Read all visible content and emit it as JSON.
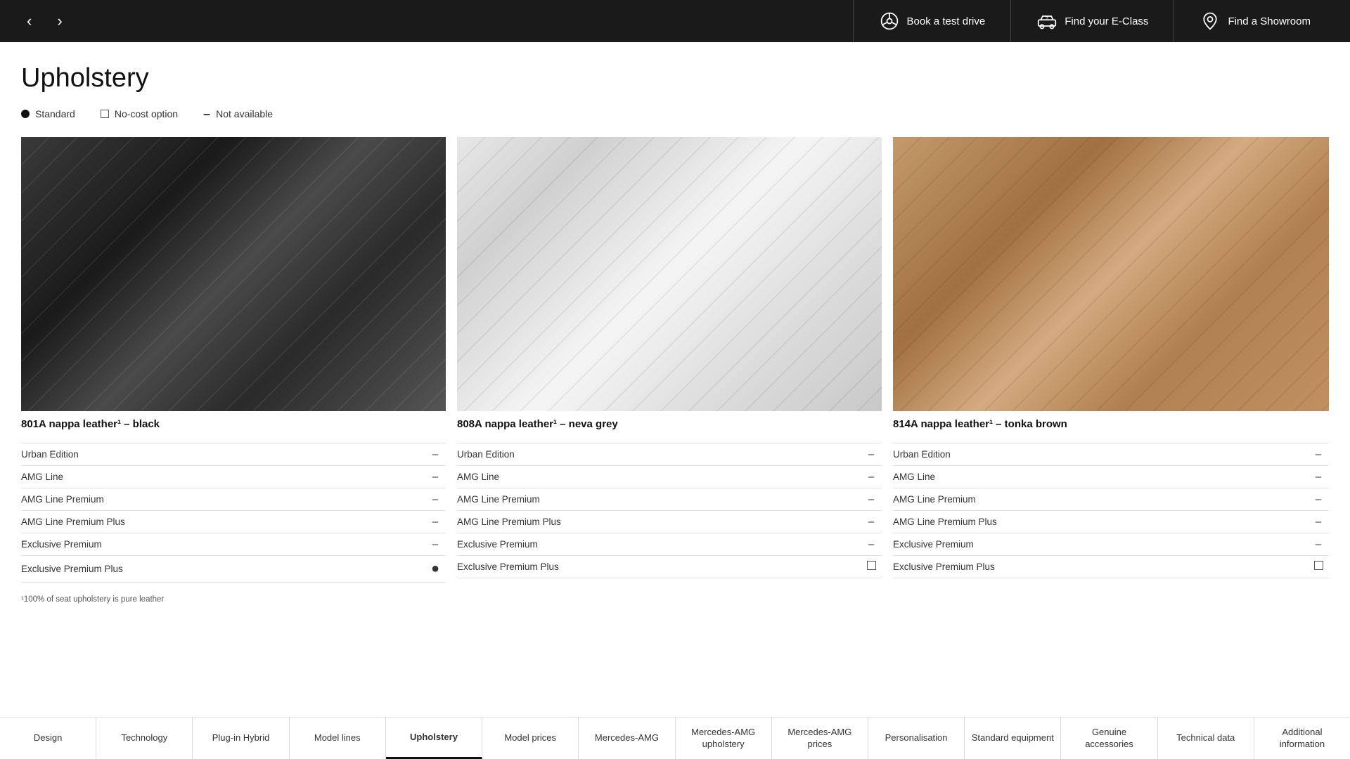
{
  "header": {
    "book_test_drive": "Book a test drive",
    "find_eclass": "Find your E-Class",
    "find_showroom": "Find a Showroom"
  },
  "page": {
    "title": "Upholstery"
  },
  "legend": {
    "standard_label": "Standard",
    "no_cost_label": "No-cost option",
    "not_available_label": "Not available"
  },
  "cards": [
    {
      "id": "black",
      "image_type": "black-seat",
      "title": "801A  nappa leather¹ – black",
      "rows": [
        {
          "label": "Urban Edition",
          "value": "–",
          "type": "dash"
        },
        {
          "label": "AMG Line",
          "value": "–",
          "type": "dash"
        },
        {
          "label": "AMG Line Premium",
          "value": "–",
          "type": "dash"
        },
        {
          "label": "AMG Line Premium Plus",
          "value": "–",
          "type": "dash"
        },
        {
          "label": "Exclusive Premium",
          "value": "–",
          "type": "dash"
        },
        {
          "label": "Exclusive Premium Plus",
          "value": "●",
          "type": "dot"
        }
      ]
    },
    {
      "id": "grey",
      "image_type": "grey-seat",
      "title": "808A  nappa leather¹ – neva grey",
      "rows": [
        {
          "label": "Urban Edition",
          "value": "–",
          "type": "dash"
        },
        {
          "label": "AMG Line",
          "value": "–",
          "type": "dash"
        },
        {
          "label": "AMG Line Premium",
          "value": "–",
          "type": "dash"
        },
        {
          "label": "AMG Line Premium Plus",
          "value": "–",
          "type": "dash"
        },
        {
          "label": "Exclusive Premium",
          "value": "–",
          "type": "dash"
        },
        {
          "label": "Exclusive Premium Plus",
          "value": "□",
          "type": "square"
        }
      ]
    },
    {
      "id": "brown",
      "image_type": "brown-seat",
      "title": "814A  nappa leather¹ – tonka brown",
      "rows": [
        {
          "label": "Urban Edition",
          "value": "–",
          "type": "dash"
        },
        {
          "label": "AMG Line",
          "value": "–",
          "type": "dash"
        },
        {
          "label": "AMG Line Premium",
          "value": "–",
          "type": "dash"
        },
        {
          "label": "AMG Line Premium Plus",
          "value": "–",
          "type": "dash"
        },
        {
          "label": "Exclusive Premium",
          "value": "–",
          "type": "dash"
        },
        {
          "label": "Exclusive Premium Plus",
          "value": "□",
          "type": "square"
        }
      ]
    }
  ],
  "footnote": "¹100% of seat upholstery is pure leather",
  "bottom_nav": [
    {
      "label": "Design",
      "active": false
    },
    {
      "label": "Technology",
      "active": false
    },
    {
      "label": "Plug-in Hybrid",
      "active": false
    },
    {
      "label": "Model lines",
      "active": false
    },
    {
      "label": "Upholstery",
      "active": true
    },
    {
      "label": "Model prices",
      "active": false
    },
    {
      "label": "Mercedes-AMG",
      "active": false
    },
    {
      "label": "Mercedes-AMG upholstery",
      "active": false
    },
    {
      "label": "Mercedes-AMG prices",
      "active": false
    },
    {
      "label": "Personalisation",
      "active": false
    },
    {
      "label": "Standard equipment",
      "active": false
    },
    {
      "label": "Genuine accessories",
      "active": false
    },
    {
      "label": "Technical data",
      "active": false
    },
    {
      "label": "Additional information",
      "active": false
    }
  ]
}
